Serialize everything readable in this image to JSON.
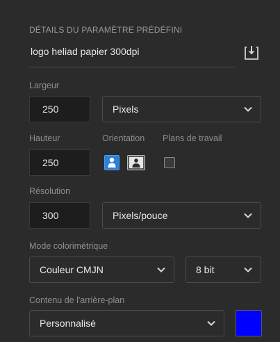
{
  "section": {
    "title": "DÉTAILS DU PARAMÈTRE PRÉDÉFINI"
  },
  "preset": {
    "name": "logo heliad papier 300dpi",
    "save_icon": "save-preset-icon"
  },
  "width": {
    "label": "Largeur",
    "value": "250",
    "unit": "Pixels"
  },
  "height": {
    "label": "Hauteur",
    "value": "250"
  },
  "orientation": {
    "label": "Orientation",
    "selected": "portrait",
    "portrait_icon": "portrait-icon",
    "landscape_icon": "landscape-icon"
  },
  "artboards": {
    "label": "Plans de travail",
    "checked": false
  },
  "resolution": {
    "label": "Résolution",
    "value": "300",
    "unit": "Pixels/pouce"
  },
  "color_mode": {
    "label": "Mode colorimétrique",
    "mode": "Couleur CMJN",
    "depth": "8 bit"
  },
  "background": {
    "label": "Contenu de l'arrière-plan",
    "value": "Personnalisé",
    "color": "#0000ff"
  },
  "colors": {
    "accent": "#2d7fd8",
    "panel": "#2b2b2b"
  }
}
